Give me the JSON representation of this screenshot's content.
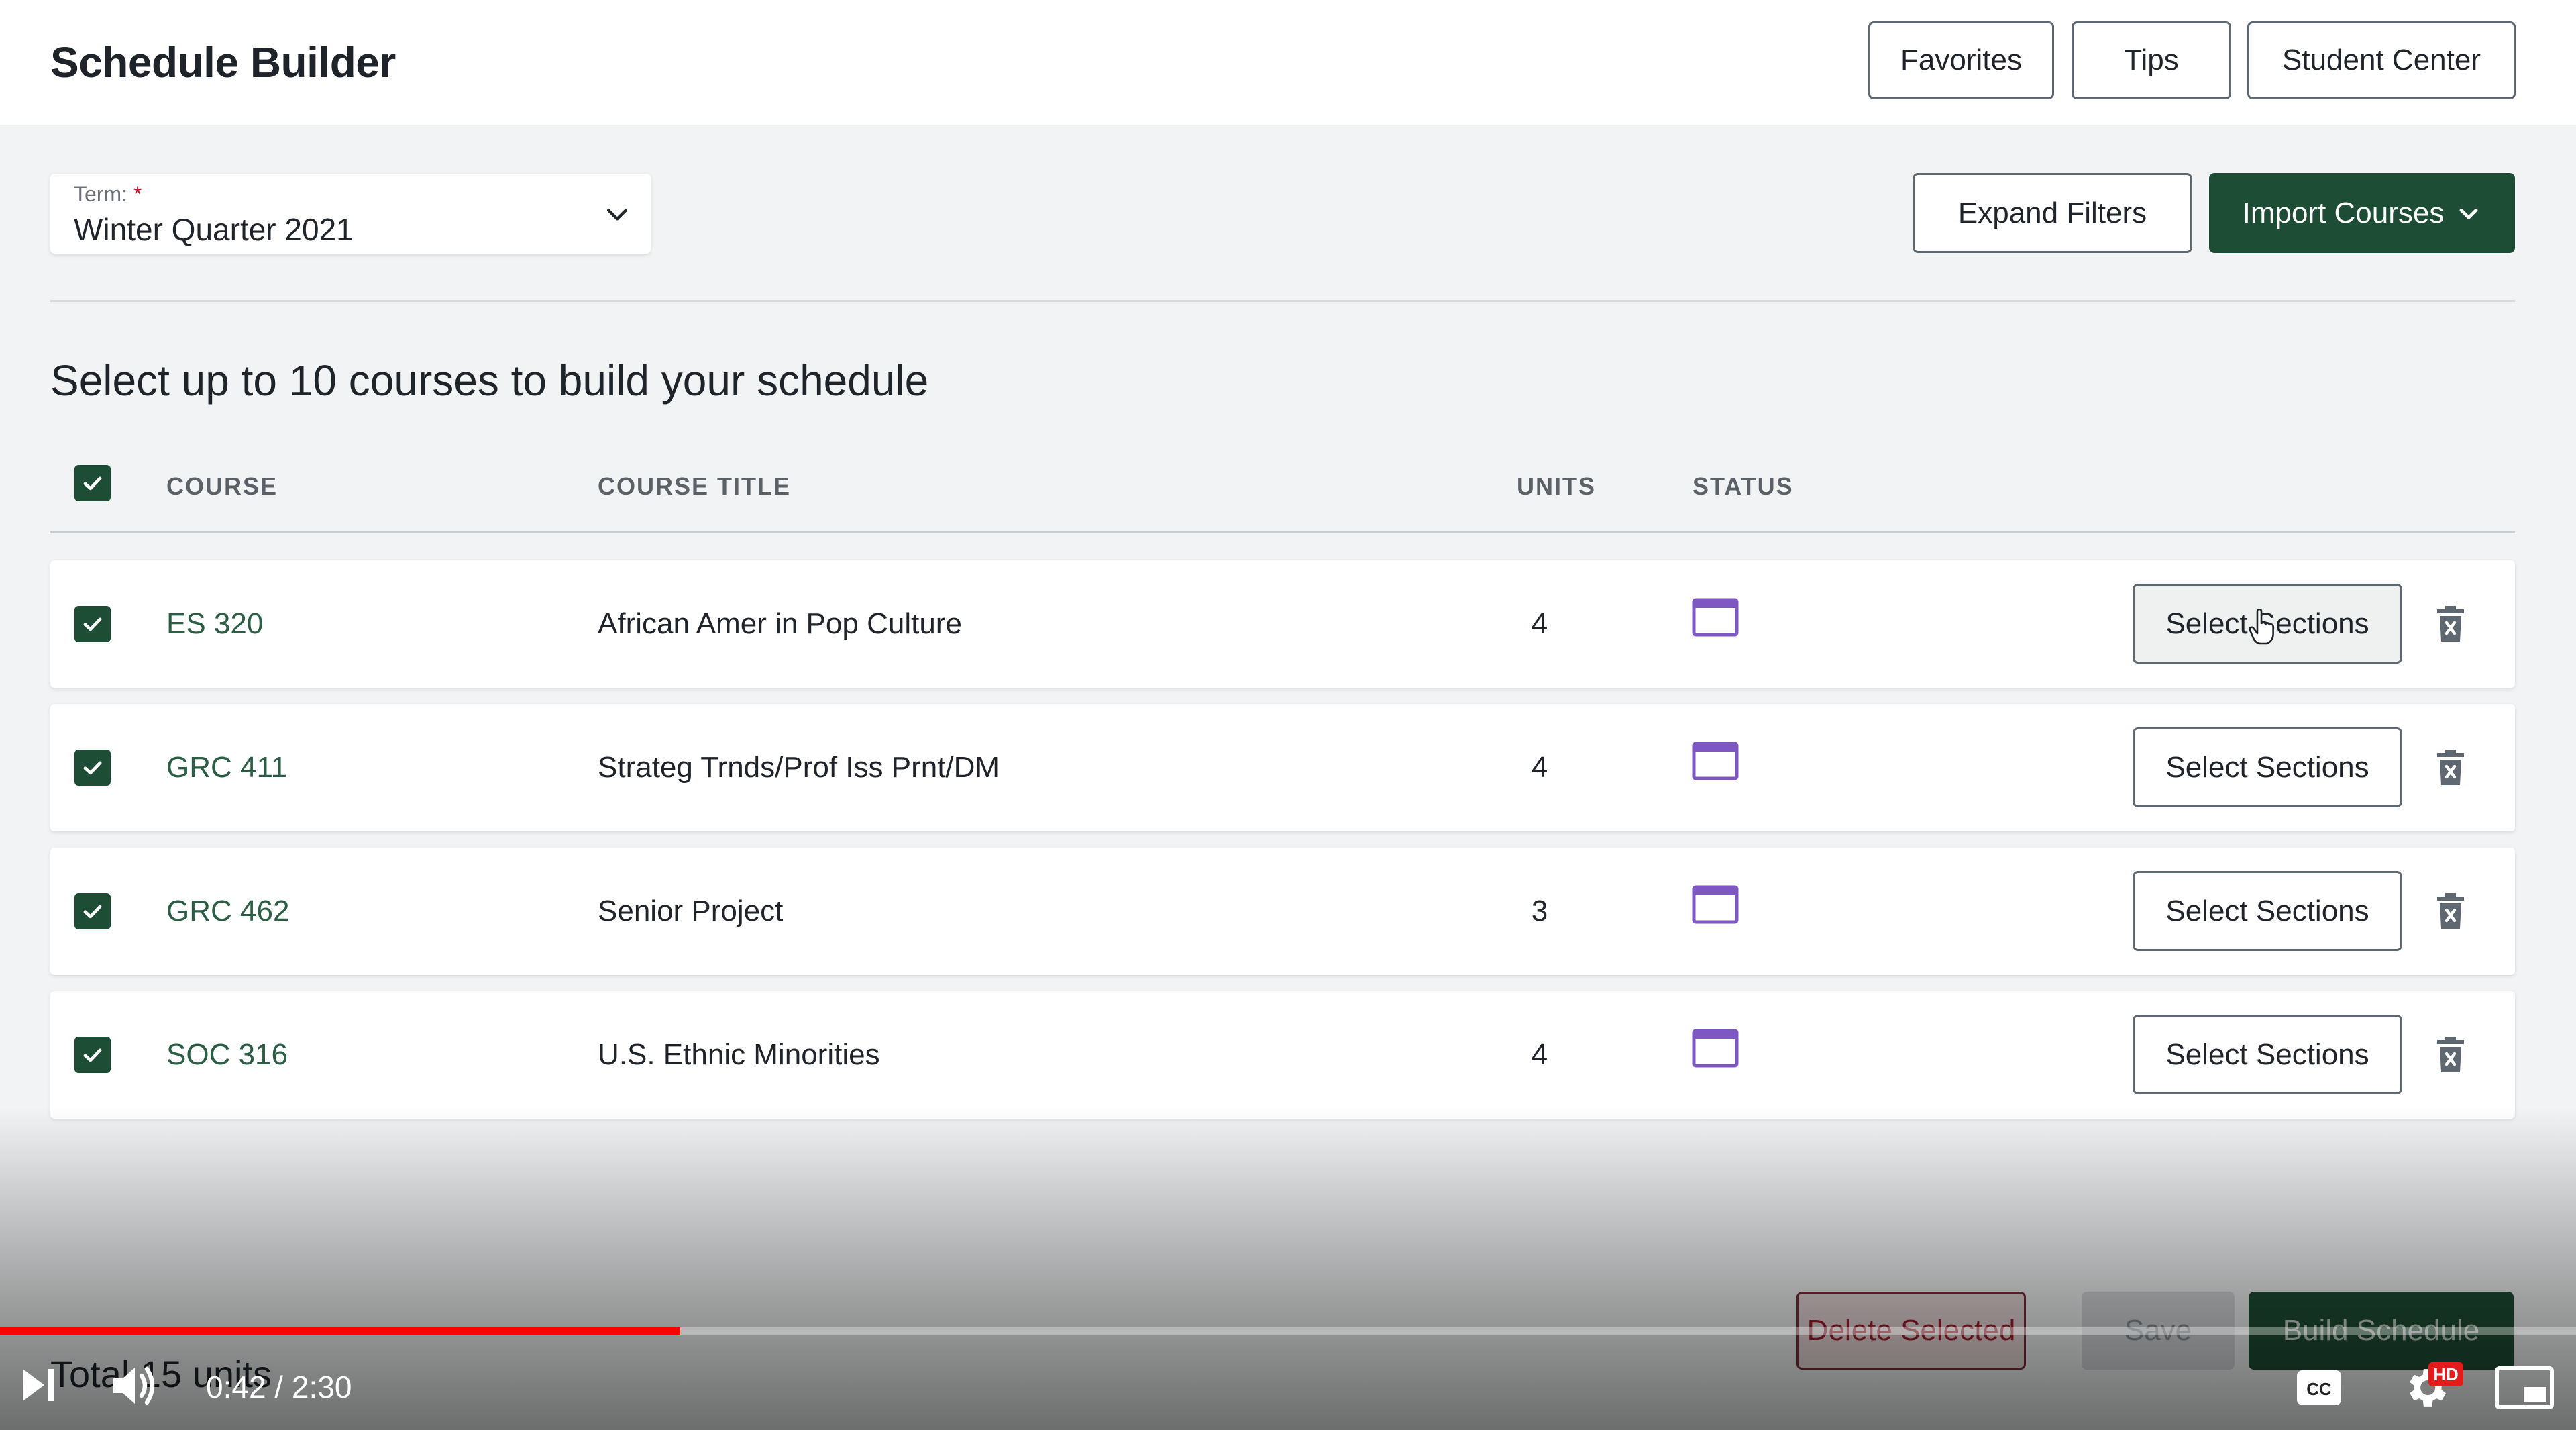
{
  "header": {
    "title": "Schedule Builder",
    "buttons": [
      "Favorites",
      "Tips",
      "Student Center"
    ]
  },
  "term": {
    "label": "Term:",
    "required_mark": "*",
    "value": "Winter Quarter 2021"
  },
  "actions": {
    "expand_filters": "Expand Filters",
    "import_courses": "Import Courses"
  },
  "instructions": "Select up to 10 courses to build your schedule",
  "table": {
    "columns": {
      "course": "COURSE",
      "title": "COURSE TITLE",
      "units": "UNITS",
      "status": "STATUS"
    },
    "select_all_checked": true,
    "rows": [
      {
        "course": "ES 320",
        "title": "African Amer in Pop Culture",
        "units": "4",
        "action": "Select Sections",
        "checked": true
      },
      {
        "course": "GRC 411",
        "title": "Strateg Trnds/Prof Iss Prnt/DM",
        "units": "4",
        "action": "Select Sections",
        "checked": true
      },
      {
        "course": "GRC 462",
        "title": "Senior Project",
        "units": "3",
        "action": "Select Sections",
        "checked": true
      },
      {
        "course": "SOC 316",
        "title": "U.S. Ethnic Minorities",
        "units": "4",
        "action": "Select Sections",
        "checked": true
      }
    ]
  },
  "footer": {
    "total": "Total 15 units",
    "delete_selected": "Delete Selected",
    "save": "Save",
    "build_schedule": "Build Schedule"
  },
  "video": {
    "time": "0:42 / 2:30",
    "progress_fraction": 0.264,
    "quality_badge": "HD",
    "accent": "#ff0000"
  },
  "colors": {
    "brand_green": "#1e4d35",
    "status_icon": "#7e57c2",
    "delete_red": "#a01c2c"
  },
  "icons": {
    "term_dropdown": "chevron-down-icon",
    "status": "window-icon",
    "row_delete": "trash-icon",
    "checkbox": "check-icon"
  }
}
